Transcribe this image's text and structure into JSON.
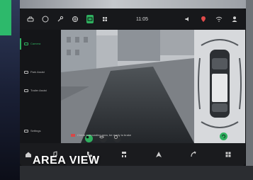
{
  "overlay_title": "AREA VIEW",
  "status_bar": {
    "time": "11:05",
    "icons": [
      "car-icon",
      "phone-circle-icon",
      "wrench-icon",
      "fan-icon",
      "camera-icon",
      "grid-icon",
      "volume-icon",
      "location-icon",
      "wifi-icon",
      "user-icon"
    ]
  },
  "sidebar": {
    "items": [
      {
        "label": "Camera",
        "icon": "camera-icon",
        "active": true
      },
      {
        "label": "Park Assist",
        "icon": "park-icon",
        "active": false
      },
      {
        "label": "Trailer Assist",
        "icon": "trailer-icon",
        "active": false
      },
      {
        "label": "Settings",
        "icon": "gear-icon",
        "active": false
      }
    ]
  },
  "camera": {
    "notice": "Check surrounding area, be ready to brake"
  },
  "dock": {
    "items": [
      "home-icon",
      "music-icon",
      "phone-icon",
      "apps-icon",
      "navigation-icon",
      "media-icon",
      "grid-icon"
    ]
  },
  "colors": {
    "accent": "#2fb05f",
    "warning": "#d74848"
  }
}
